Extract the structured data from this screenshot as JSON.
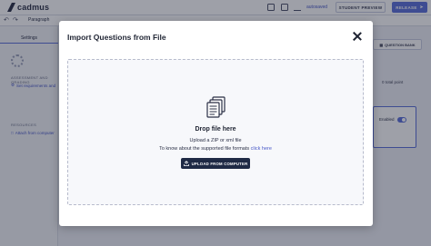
{
  "app": {
    "logo_text": "cadmus",
    "status": "autosaved",
    "preview_label": "STUDENT PREVIEW",
    "release_label": "RELEASE"
  },
  "toolbar": {
    "paragraph_label": "Paragraph"
  },
  "left_panel": {
    "settings_tab": "Settings",
    "assessment_heading": "ASSESSMENT AND GRADING",
    "requirements_link": "Set requirements and",
    "resources_heading": "RESOURCES",
    "attach_link": "Attach from computer"
  },
  "right_panel": {
    "question_bank_label": "QUESTION BANK",
    "total_point": "0 total point",
    "enabled_label": "Enabled"
  },
  "modal": {
    "title": "Import Questions from File",
    "drop_title": "Drop file here",
    "drop_subtitle": "Upload a ZIP or xml file",
    "info_text": "To know about the supported file formats",
    "info_link": "click here",
    "upload_button": "UPLOAD FROM COMPUTER"
  },
  "colors": {
    "accent": "#5b6fd9",
    "upload_button_bg": "#1f2a45",
    "link": "#4757c7"
  }
}
